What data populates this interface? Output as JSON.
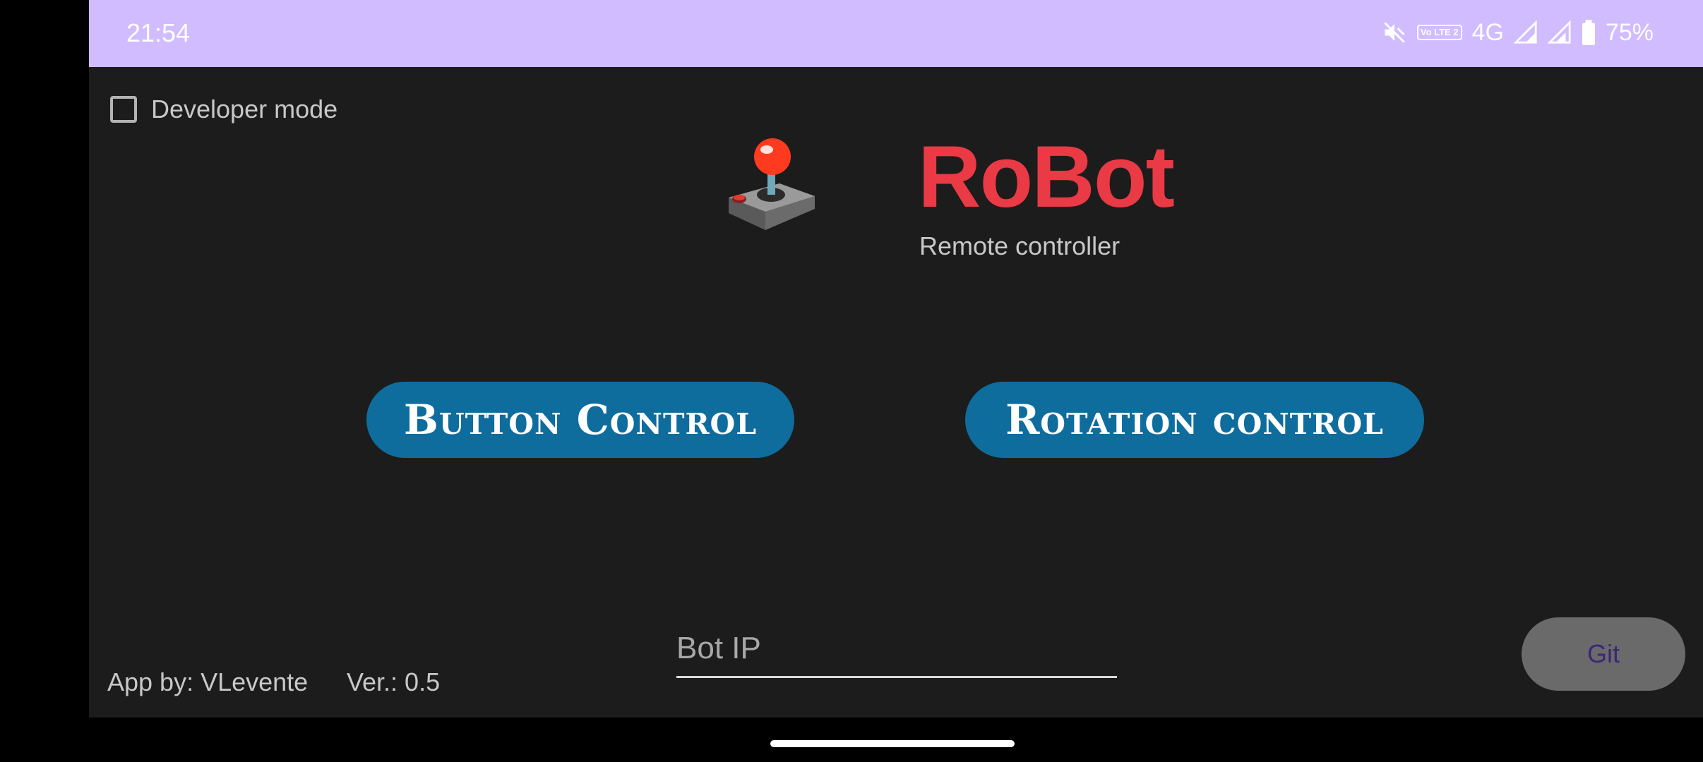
{
  "status_bar": {
    "time": "21:54",
    "network": "4G",
    "volte": "Vo LTE 2",
    "battery": "75%",
    "icons": [
      "mute-icon",
      "volte-icon",
      "signal-icon",
      "signal-icon",
      "battery-icon"
    ]
  },
  "developer_mode": {
    "label": "Developer mode",
    "checked": false
  },
  "logo": {
    "title": "RoBot",
    "subtitle": "Remote controller",
    "icon": "joystick-icon"
  },
  "controls": {
    "button_control": "Button Control",
    "rotation_control": "Rotation control"
  },
  "bot_ip": {
    "placeholder": "Bot IP",
    "value": ""
  },
  "git_button": "Git",
  "footer": {
    "author": "App by: VLevente",
    "version": "Ver.: 0.5"
  },
  "colors": {
    "status_bar": "#d0bcff",
    "background": "#1c1c1c",
    "title": "#e93a45",
    "control_button": "#0f6d9e",
    "git_button": "#6a6a6a"
  }
}
